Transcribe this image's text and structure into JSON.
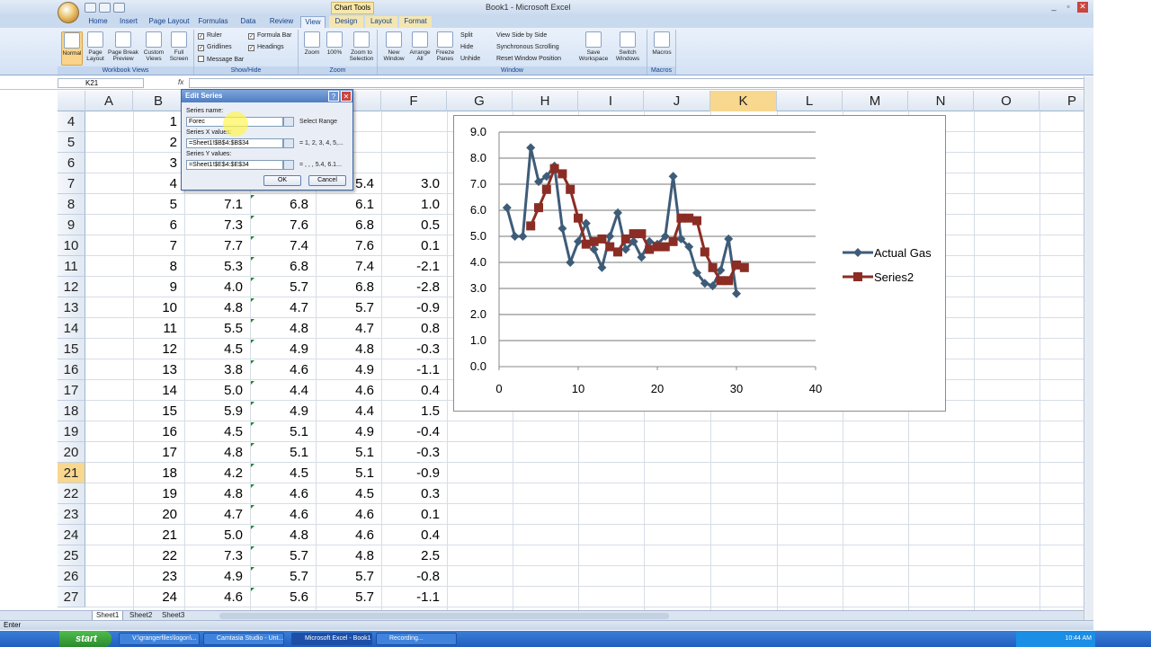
{
  "window": {
    "title": "Book1 - Microsoft Excel",
    "context_tab": "Chart Tools"
  },
  "ribbon": {
    "tabs": [
      "Home",
      "Insert",
      "Page Layout",
      "Formulas",
      "Data",
      "Review",
      "View",
      "Design",
      "Layout",
      "Format"
    ],
    "active_tab": "View",
    "groups": [
      {
        "label": "Workbook Views",
        "buttons": [
          "Normal",
          "Page Layout",
          "Page Break Preview",
          "Custom Views",
          "Full Screen"
        ]
      },
      {
        "label": "Show/Hide",
        "checks": [
          "Ruler",
          "Gridlines",
          "Message Bar",
          "Formula Bar",
          "Headings"
        ]
      },
      {
        "label": "Zoom",
        "buttons": [
          "Zoom",
          "100%",
          "Zoom to Selection"
        ]
      },
      {
        "label": "Window",
        "buttons": [
          "New Window",
          "Arrange All",
          "Freeze Panes"
        ],
        "small": [
          "Split",
          "Hide",
          "Unhide",
          "View Side by Side",
          "Synchronous Scrolling",
          "Reset Window Position"
        ],
        "big2": [
          "Save Workspace",
          "Switch Windows"
        ]
      },
      {
        "label": "Macros",
        "buttons": [
          "Macros"
        ]
      }
    ]
  },
  "formula_bar": {
    "name_box": "K21",
    "fx": "fx",
    "value": ""
  },
  "grid": {
    "columns": [
      "A",
      "B",
      "C",
      "D",
      "E",
      "F",
      "G",
      "H",
      "I",
      "J",
      "K",
      "L",
      "M",
      "N",
      "O",
      "P"
    ],
    "selected_column": "K",
    "selected_row": "21",
    "rows": [
      {
        "r": "4",
        "b": "1",
        "c": "",
        "d": "",
        "e": "",
        "f": ""
      },
      {
        "r": "5",
        "b": "2",
        "c": "",
        "d": "",
        "e": "",
        "f": ""
      },
      {
        "r": "6",
        "b": "3",
        "c": "",
        "d": "",
        "e": "",
        "f": ""
      },
      {
        "r": "7",
        "b": "4",
        "c": "",
        "d": "",
        "e": "5.4",
        "f": "3.0"
      },
      {
        "r": "8",
        "b": "5",
        "c": "7.1",
        "d": "6.8",
        "e": "6.1",
        "f": "1.0"
      },
      {
        "r": "9",
        "b": "6",
        "c": "7.3",
        "d": "7.6",
        "e": "6.8",
        "f": "0.5"
      },
      {
        "r": "10",
        "b": "7",
        "c": "7.7",
        "d": "7.4",
        "e": "7.6",
        "f": "0.1"
      },
      {
        "r": "11",
        "b": "8",
        "c": "5.3",
        "d": "6.8",
        "e": "7.4",
        "f": "-2.1"
      },
      {
        "r": "12",
        "b": "9",
        "c": "4.0",
        "d": "5.7",
        "e": "6.8",
        "f": "-2.8"
      },
      {
        "r": "13",
        "b": "10",
        "c": "4.8",
        "d": "4.7",
        "e": "5.7",
        "f": "-0.9"
      },
      {
        "r": "14",
        "b": "11",
        "c": "5.5",
        "d": "4.8",
        "e": "4.7",
        "f": "0.8"
      },
      {
        "r": "15",
        "b": "12",
        "c": "4.5",
        "d": "4.9",
        "e": "4.8",
        "f": "-0.3"
      },
      {
        "r": "16",
        "b": "13",
        "c": "3.8",
        "d": "4.6",
        "e": "4.9",
        "f": "-1.1"
      },
      {
        "r": "17",
        "b": "14",
        "c": "5.0",
        "d": "4.4",
        "e": "4.6",
        "f": "0.4"
      },
      {
        "r": "18",
        "b": "15",
        "c": "5.9",
        "d": "4.9",
        "e": "4.4",
        "f": "1.5"
      },
      {
        "r": "19",
        "b": "16",
        "c": "4.5",
        "d": "5.1",
        "e": "4.9",
        "f": "-0.4"
      },
      {
        "r": "20",
        "b": "17",
        "c": "4.8",
        "d": "5.1",
        "e": "5.1",
        "f": "-0.3"
      },
      {
        "r": "21",
        "b": "18",
        "c": "4.2",
        "d": "4.5",
        "e": "5.1",
        "f": "-0.9"
      },
      {
        "r": "22",
        "b": "19",
        "c": "4.8",
        "d": "4.6",
        "e": "4.5",
        "f": "0.3"
      },
      {
        "r": "23",
        "b": "20",
        "c": "4.7",
        "d": "4.6",
        "e": "4.6",
        "f": "0.1"
      },
      {
        "r": "24",
        "b": "21",
        "c": "5.0",
        "d": "4.8",
        "e": "4.6",
        "f": "0.4"
      },
      {
        "r": "25",
        "b": "22",
        "c": "7.3",
        "d": "5.7",
        "e": "4.8",
        "f": "2.5"
      },
      {
        "r": "26",
        "b": "23",
        "c": "4.9",
        "d": "5.7",
        "e": "5.7",
        "f": "-0.8"
      },
      {
        "r": "27",
        "b": "24",
        "c": "4.6",
        "d": "5.6",
        "e": "5.7",
        "f": "-1.1"
      }
    ]
  },
  "dialog": {
    "title": "Edit Series",
    "series_name_label": "Series name:",
    "series_name_value": "Forec",
    "series_name_hint": "Select Range",
    "x_label": "Series X values:",
    "x_value": "=Sheet1!$B$4:$B$34",
    "x_preview": "= 1, 2, 3, 4, 5,...",
    "y_label": "Series Y values:",
    "y_value": "=Sheet1!$E$4:$E$34",
    "y_preview": "= , , , 5.4, 6.1...",
    "ok": "OK",
    "cancel": "Cancel"
  },
  "chart_data": {
    "type": "scatter",
    "xlim": [
      0,
      40
    ],
    "ylim": [
      0,
      9
    ],
    "x_ticks": [
      "0",
      "10",
      "20",
      "30",
      "40"
    ],
    "y_ticks": [
      "0.0",
      "1.0",
      "2.0",
      "3.0",
      "4.0",
      "5.0",
      "6.0",
      "7.0",
      "8.0",
      "9.0"
    ],
    "grid": "horizontal",
    "legend_position": "right",
    "series": [
      {
        "name": "Actual Gas",
        "color": "#3e5c78",
        "marker": "diamond",
        "x": [
          1,
          2,
          3,
          4,
          5,
          6,
          7,
          8,
          9,
          10,
          11,
          12,
          13,
          14,
          15,
          16,
          17,
          18,
          19,
          20,
          21,
          22,
          23,
          24,
          25,
          26,
          27,
          28,
          29,
          30
        ],
        "y": [
          6.1,
          5.0,
          5.0,
          8.4,
          7.1,
          7.3,
          7.7,
          5.3,
          4.0,
          4.8,
          5.5,
          4.5,
          3.8,
          5.0,
          5.9,
          4.5,
          4.8,
          4.2,
          4.8,
          4.7,
          5.0,
          7.3,
          4.9,
          4.6,
          3.6,
          3.2,
          3.1,
          3.7,
          4.9,
          2.8
        ]
      },
      {
        "name": "Series2",
        "color": "#8b2d24",
        "marker": "square",
        "x": [
          4,
          5,
          6,
          7,
          8,
          9,
          10,
          11,
          12,
          13,
          14,
          15,
          16,
          17,
          18,
          19,
          20,
          21,
          22,
          23,
          24,
          25,
          26,
          27,
          28,
          29,
          30,
          31
        ],
        "y": [
          5.4,
          6.1,
          6.8,
          7.6,
          7.4,
          6.8,
          5.7,
          4.7,
          4.8,
          4.9,
          4.6,
          4.4,
          4.9,
          5.1,
          5.1,
          4.5,
          4.6,
          4.6,
          4.8,
          5.7,
          5.7,
          5.6,
          4.4,
          3.8,
          3.3,
          3.3,
          3.9,
          3.8
        ]
      }
    ]
  },
  "sheets": {
    "tabs": [
      "Sheet1",
      "Sheet2",
      "Sheet3"
    ],
    "active": "Sheet1"
  },
  "status": {
    "mode": "Enter"
  },
  "taskbar": {
    "start": "start",
    "items": [
      "V:\\grangerfiles\\logon\\...",
      "Camtasia Studio - Unt...",
      "Microsoft Excel - Book1",
      "Recording..."
    ],
    "active": "Microsoft Excel - Book1",
    "clock": "10:44 AM"
  }
}
